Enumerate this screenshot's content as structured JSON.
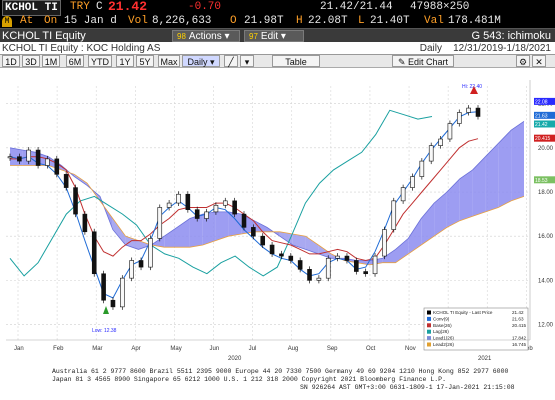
{
  "quote": {
    "ticker": "KCHOL TI",
    "currency": "TRY",
    "change_flag": "C",
    "last": "21.42",
    "change": "-0.70",
    "bid_ask": "21.42/21.44",
    "size": "47988×250",
    "at_label": "At",
    "session": "On",
    "date": "15 Jan d",
    "vol_label": "Vol",
    "volume": "8,226,633",
    "open_label": "O",
    "open": "21.98T",
    "high_label": "H",
    "high": "22.08T",
    "low_label": "L",
    "low": "21.40T",
    "val_label": "Val",
    "value": "178.481M"
  },
  "function_bar": {
    "title": "KCHOL TI Equity",
    "actions_num": "98",
    "actions_label": "Actions",
    "edit_num": "97",
    "edit_label": "Edit",
    "function": "G 543: ichimoku"
  },
  "sub_header": {
    "security": "KCHOL TI Equity : KOC Holding AS",
    "period": "Daily",
    "range": "12/31/2019-1/18/2021"
  },
  "toolbar": {
    "buttons": [
      "1D",
      "3D",
      "1M",
      "6M",
      "YTD",
      "1Y",
      "5Y",
      "Max"
    ],
    "frequency": "Daily",
    "table_label": "Table",
    "edit_chart_label": "Edit Chart"
  },
  "chart_data": {
    "type": "line",
    "title": "",
    "ylim": [
      11.3,
      22.8
    ],
    "yticks": [
      "22.00",
      "20.00",
      "18.00",
      "16.00",
      "14.00",
      "12.00"
    ],
    "x_labels": [
      "Jan",
      "Feb",
      "Mar",
      "Apr",
      "May",
      "Jun",
      "Jul",
      "Aug",
      "Sep",
      "Oct",
      "Nov",
      "Dec",
      "Jan",
      "Feb"
    ],
    "year_labels": [
      "2020",
      "2021"
    ],
    "price": [
      19.6,
      19.4,
      19.9,
      19.2,
      19.5,
      18.8,
      18.2,
      17.0,
      16.2,
      14.3,
      13.1,
      12.8,
      14.1,
      14.9,
      14.6,
      15.9,
      17.3,
      17.5,
      17.9,
      17.2,
      16.8,
      17.1,
      17.4,
      17.6,
      17.0,
      16.4,
      16.0,
      15.6,
      15.2,
      15.1,
      14.9,
      14.5,
      14.0,
      14.1,
      15.0,
      15.1,
      14.9,
      14.4,
      14.3,
      15.1,
      16.3,
      17.6,
      18.2,
      18.7,
      19.4,
      20.1,
      20.4,
      21.1,
      21.6,
      21.8,
      21.42
    ],
    "conv_line": [
      19.6,
      19.5,
      19.6,
      19.3,
      19.2,
      18.8,
      18.2,
      17.1,
      15.8,
      14.6,
      13.4,
      13.2,
      14.0,
      14.7,
      14.9,
      15.8,
      16.9,
      17.3,
      17.6,
      17.3,
      16.9,
      17.0,
      17.3,
      17.2,
      16.8,
      16.3,
      15.9,
      15.5,
      15.2,
      15.0,
      14.9,
      14.5,
      14.2,
      14.3,
      14.8,
      15.0,
      14.9,
      14.5,
      14.6,
      15.3,
      16.3,
      17.4,
      18.0,
      18.6,
      19.3,
      19.9,
      20.4,
      20.9,
      21.4,
      21.6,
      21.63
    ],
    "base_line": [
      19.5,
      19.5,
      19.6,
      19.6,
      19.5,
      19.3,
      19.0,
      18.2,
      17.0,
      16.0,
      15.3,
      15.1,
      15.5,
      15.8,
      15.8,
      16.1,
      16.5,
      16.8,
      17.2,
      17.3,
      17.3,
      17.3,
      17.5,
      17.5,
      17.3,
      17.0,
      16.7,
      16.2,
      15.8,
      15.7,
      15.6,
      15.4,
      15.2,
      15.2,
      15.3,
      15.4,
      15.3,
      15.0,
      14.9,
      15.0,
      15.6,
      16.3,
      17.0,
      17.5,
      18.0,
      18.5,
      19.0,
      19.5,
      20.0,
      20.3,
      20.415
    ],
    "lag_line": [
      15.0,
      14.2,
      14.8,
      15.9,
      17.0,
      17.6,
      17.8,
      17.4,
      17.0,
      16.5,
      15.6,
      15.2,
      15.0,
      14.6,
      14.3,
      14.8,
      15.1,
      14.6,
      14.2,
      14.6,
      16.0,
      17.5,
      18.4,
      19.0,
      19.4,
      19.8,
      20.6,
      21.7,
      21.5,
      21.3,
      21.42
    ],
    "lead1": [
      20.0,
      19.9,
      19.8,
      19.6,
      19.2,
      18.7,
      18.3,
      17.8,
      16.3,
      15.6,
      15.4,
      15.6,
      16.0,
      16.4,
      16.8,
      17.0,
      17.1,
      17.1,
      17.0,
      16.7,
      16.4,
      16.0,
      15.6,
      15.4,
      15.2,
      15.0,
      15.0,
      14.9,
      14.9,
      15.0,
      15.4,
      15.9,
      16.8,
      17.5,
      18.0,
      18.6,
      19.0,
      19.6,
      20.2,
      20.8,
      21.2
    ],
    "lead2": [
      19.2,
      19.2,
      19.2,
      19.2,
      19.0,
      18.8,
      18.4,
      17.6,
      16.8,
      16.0,
      15.8,
      15.6,
      15.5,
      15.5,
      15.5,
      15.6,
      15.8,
      16.0,
      16.1,
      16.2,
      16.2,
      16.2,
      16.1,
      16.0,
      15.6,
      15.2,
      14.9,
      14.8,
      14.7,
      14.8,
      14.8,
      15.2,
      15.6,
      16.0,
      16.4,
      16.7,
      16.9,
      17.1,
      17.3,
      17.6,
      17.8
    ],
    "hi_label": "Hi: 22.40",
    "low_label": "Low: 12.38",
    "year_divider_label": "2020",
    "right_values": [
      {
        "label": "22.08",
        "color": "#2a2aff"
      },
      {
        "label": "21.63",
        "color": "#1f6bd6"
      },
      {
        "label": "21.42",
        "color": "#17aaaa"
      },
      {
        "label": "20.415",
        "color": "#d02020"
      },
      {
        "label": "18.53",
        "color": "#7bc062"
      }
    ],
    "legend": [
      {
        "name": "KCHOL TI Equity - Last Price",
        "value": "21.42",
        "color": "#000000"
      },
      {
        "name": "Conv(9)",
        "value": "21.63",
        "color": "#1f6bd6"
      },
      {
        "name": "Base(26)",
        "value": "20.415",
        "color": "#c03030"
      },
      {
        "name": "Lag(26)",
        "value": "",
        "color": "#19a0a0"
      },
      {
        "name": "Lead1(26)",
        "value": "17.842",
        "color": "#7b8bd8"
      },
      {
        "name": "Lead2(26)",
        "value": "16.745",
        "color": "#e0a030"
      }
    ]
  },
  "footer": {
    "line1": "Australia 61 2 9777 8600  Brazil 5511 2395 9000  Europe 44 20 7330 7500  Germany 49 69 9204 1210  Hong Kong 852 2977 6000",
    "line2": "Japan 81 3 4565 8900        Singapore 65 6212 1000        U.S. 1 212 318 2000        Copyright 2021 Bloomberg Finance L.P.",
    "line3": "SN 926264 AST  GMT+3:00 G631-1809-1 17-Jan-2021 21:15:08"
  }
}
